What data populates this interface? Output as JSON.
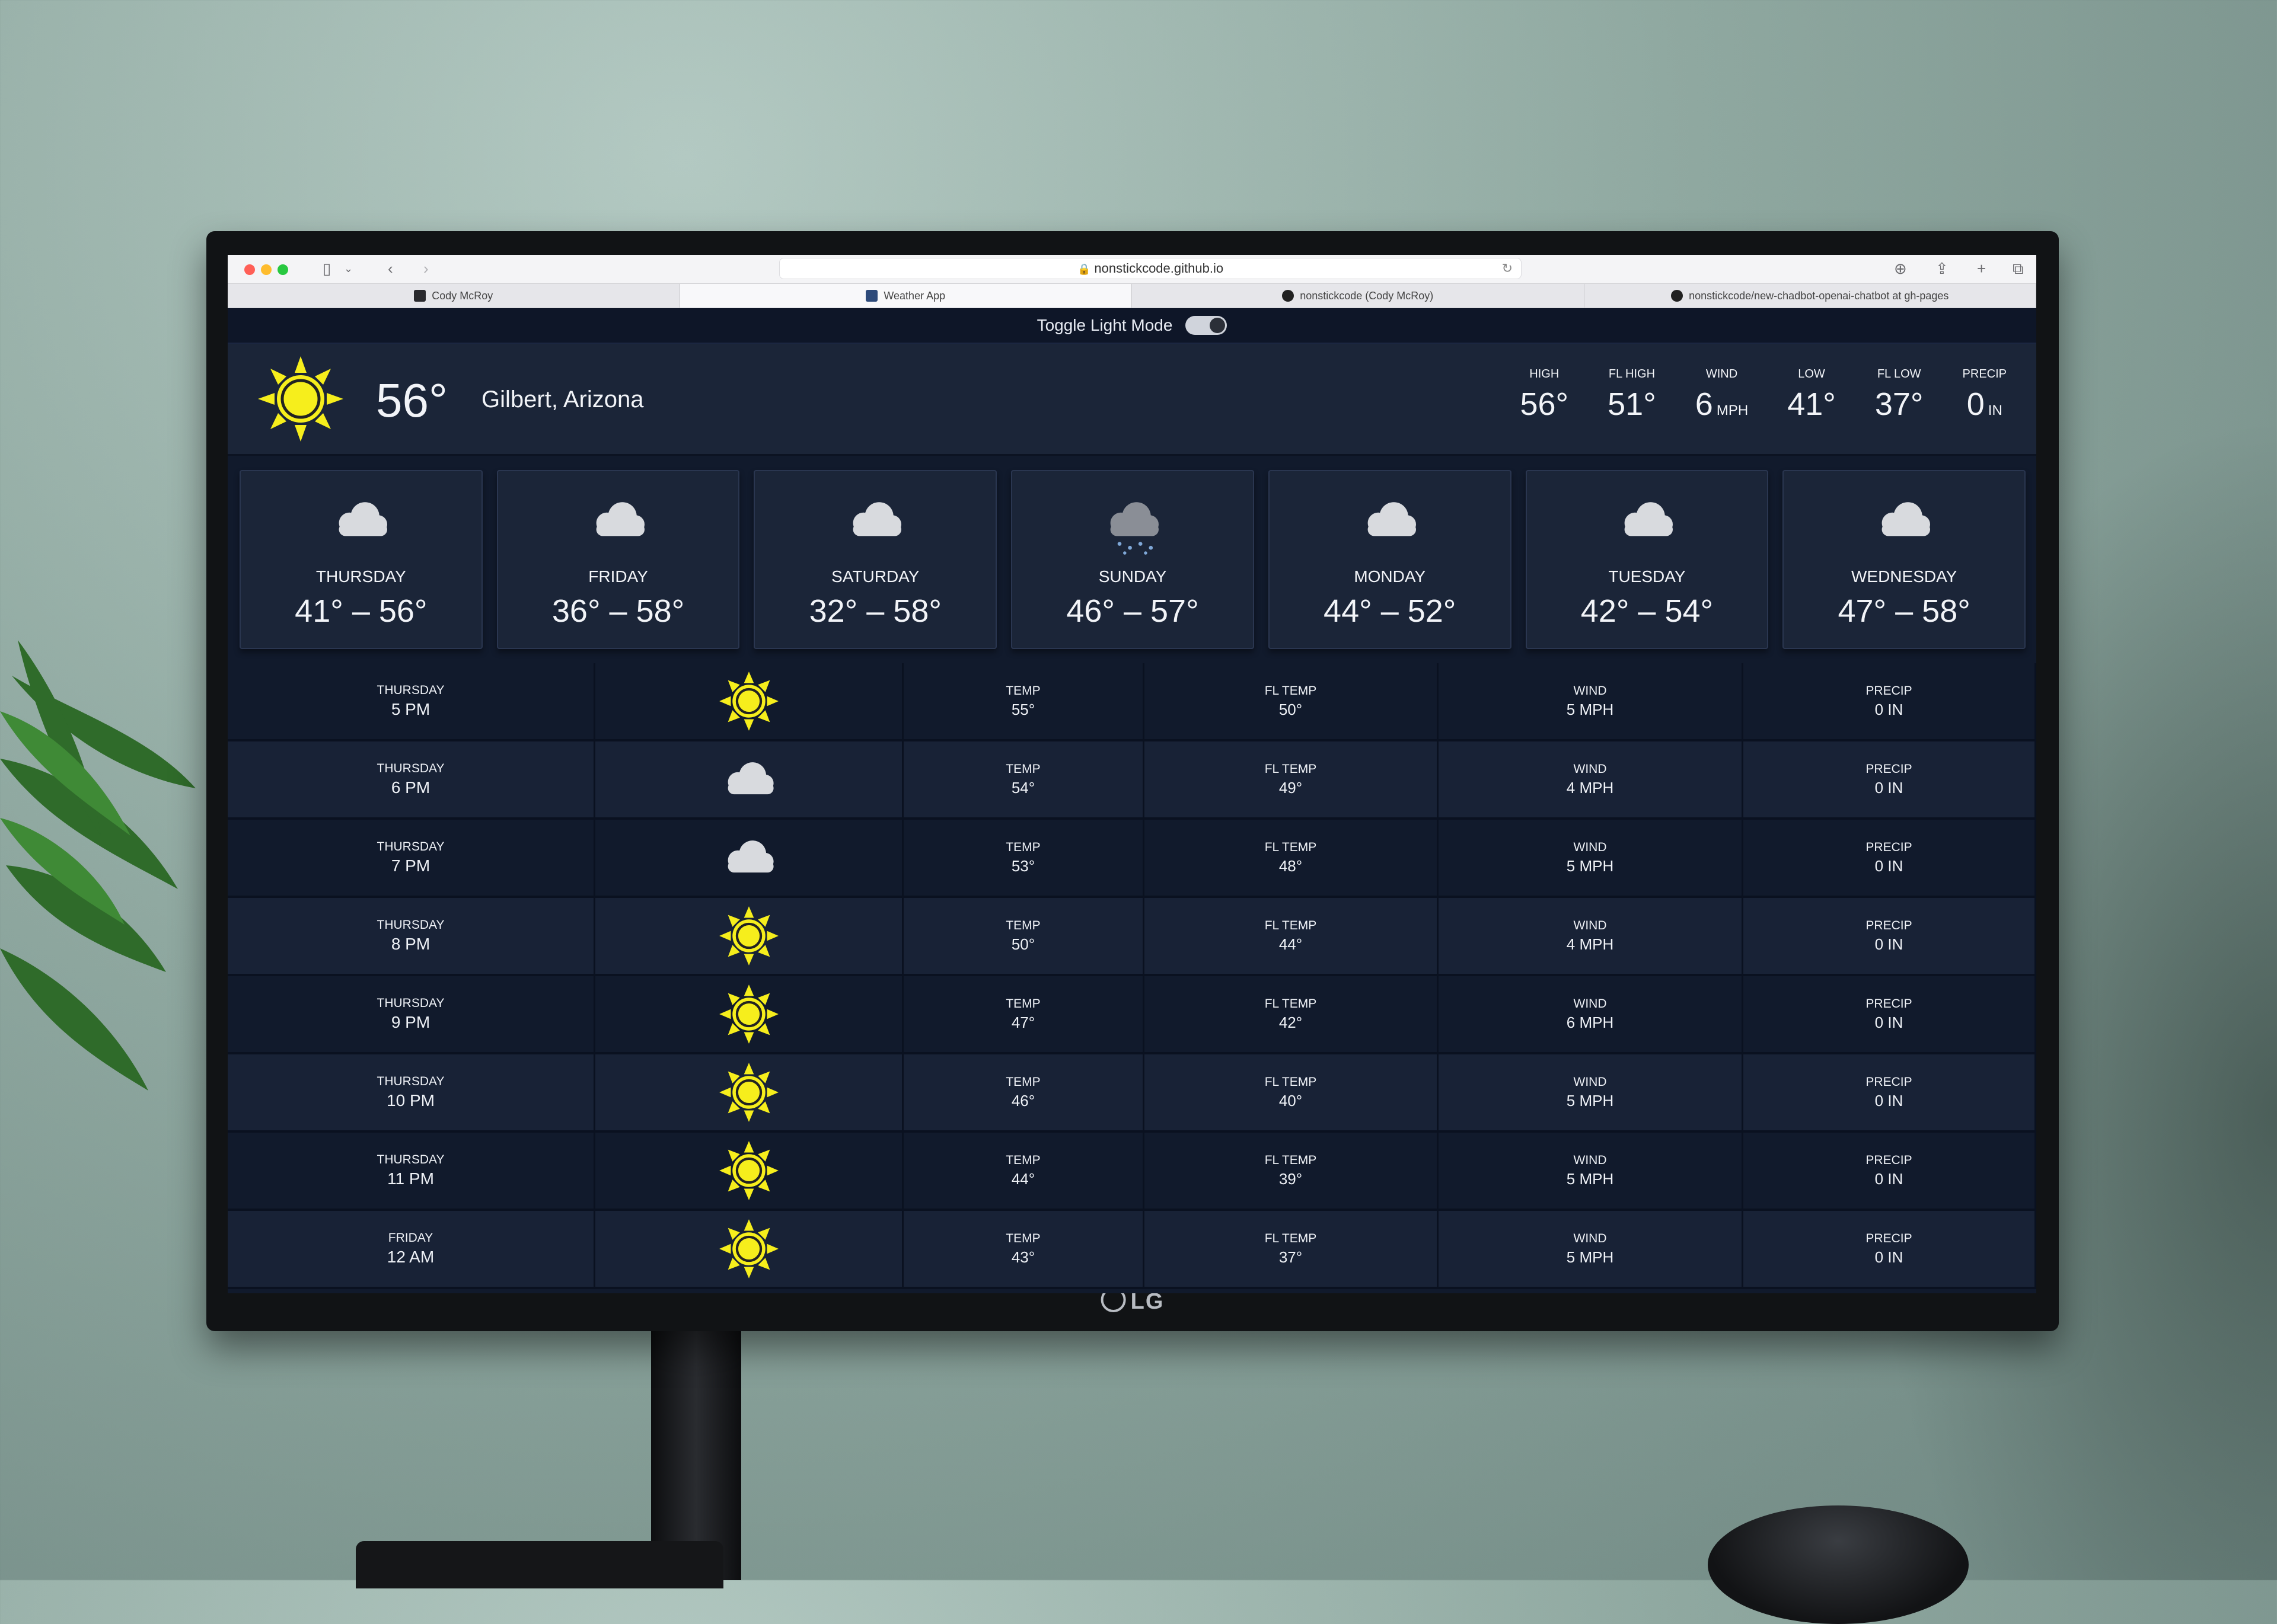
{
  "browser": {
    "url": "nonstickcode.github.io",
    "tabs": [
      {
        "title": "Cody McRoy",
        "active": false
      },
      {
        "title": "Weather App",
        "active": true
      },
      {
        "title": "nonstickcode (Cody McRoy)",
        "active": false
      },
      {
        "title": "nonstickcode/new-chadbot-openai-chatbot at gh-pages",
        "active": false
      }
    ]
  },
  "toggle": {
    "label": "Toggle Light Mode"
  },
  "current": {
    "temp": "56°",
    "location": "Gilbert, Arizona",
    "icon": "sun-icon",
    "stats": [
      {
        "label": "HIGH",
        "value": "56°",
        "unit": ""
      },
      {
        "label": "FL HIGH",
        "value": "51°",
        "unit": ""
      },
      {
        "label": "WIND",
        "value": "6",
        "unit": "MPH"
      },
      {
        "label": "LOW",
        "value": "41°",
        "unit": ""
      },
      {
        "label": "FL LOW",
        "value": "37°",
        "unit": ""
      },
      {
        "label": "PRECIP",
        "value": "0",
        "unit": "IN"
      }
    ]
  },
  "daily": [
    {
      "day": "THURSDAY",
      "range": "41° – 56°",
      "icon": "cloud-icon"
    },
    {
      "day": "FRIDAY",
      "range": "36° – 58°",
      "icon": "cloud-icon"
    },
    {
      "day": "SATURDAY",
      "range": "32° – 58°",
      "icon": "cloud-icon"
    },
    {
      "day": "SUNDAY",
      "range": "46° – 57°",
      "icon": "snow-cloud-icon"
    },
    {
      "day": "MONDAY",
      "range": "44° – 52°",
      "icon": "cloud-icon"
    },
    {
      "day": "TUESDAY",
      "range": "42° – 54°",
      "icon": "cloud-icon"
    },
    {
      "day": "WEDNESDAY",
      "range": "47° – 58°",
      "icon": "cloud-icon"
    }
  ],
  "hourly_labels": {
    "temp": "TEMP",
    "fl_temp": "FL TEMP",
    "wind": "WIND",
    "precip": "PRECIP"
  },
  "hourly": [
    {
      "day": "THURSDAY",
      "time": "5 PM",
      "icon": "sun-icon",
      "temp": "55°",
      "fl_temp": "50°",
      "wind": "5 MPH",
      "precip": "0 IN"
    },
    {
      "day": "THURSDAY",
      "time": "6 PM",
      "icon": "cloud-icon",
      "temp": "54°",
      "fl_temp": "49°",
      "wind": "4 MPH",
      "precip": "0 IN"
    },
    {
      "day": "THURSDAY",
      "time": "7 PM",
      "icon": "cloud-icon",
      "temp": "53°",
      "fl_temp": "48°",
      "wind": "5 MPH",
      "precip": "0 IN"
    },
    {
      "day": "THURSDAY",
      "time": "8 PM",
      "icon": "sun-icon",
      "temp": "50°",
      "fl_temp": "44°",
      "wind": "4 MPH",
      "precip": "0 IN"
    },
    {
      "day": "THURSDAY",
      "time": "9 PM",
      "icon": "sun-icon",
      "temp": "47°",
      "fl_temp": "42°",
      "wind": "6 MPH",
      "precip": "0 IN"
    },
    {
      "day": "THURSDAY",
      "time": "10 PM",
      "icon": "sun-icon",
      "temp": "46°",
      "fl_temp": "40°",
      "wind": "5 MPH",
      "precip": "0 IN"
    },
    {
      "day": "THURSDAY",
      "time": "11 PM",
      "icon": "sun-icon",
      "temp": "44°",
      "fl_temp": "39°",
      "wind": "5 MPH",
      "precip": "0 IN"
    },
    {
      "day": "FRIDAY",
      "time": "12 AM",
      "icon": "sun-icon",
      "temp": "43°",
      "fl_temp": "37°",
      "wind": "5 MPH",
      "precip": "0 IN"
    }
  ],
  "monitor": {
    "brand": "LG"
  },
  "colors": {
    "sun": "#f6ee1c",
    "cloud": "#d8dade",
    "panel": "#1b2538",
    "background": "#111a2c"
  }
}
